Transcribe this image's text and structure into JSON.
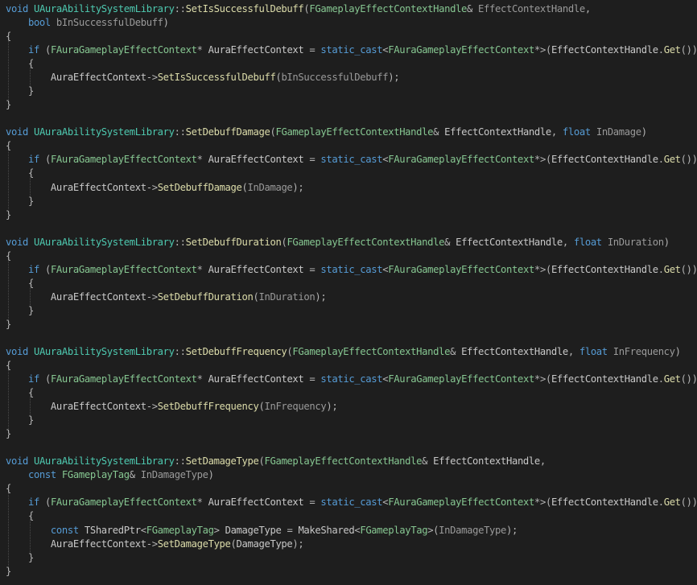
{
  "editor": {
    "colors": {
      "background": "#1e1e1e",
      "keyword": "#569cd6",
      "class": "#4ec9b0",
      "function": "#dcdcaa",
      "parameter": "#9a9a9a",
      "punctuation": "#b4b4b4",
      "variable": "#c8c8c8"
    },
    "lines": [
      [
        [
          "kw",
          "void"
        ],
        [
          "var",
          " "
        ],
        [
          "cls",
          "UAuraAbilitySystemLibrary"
        ],
        [
          "pun",
          "::"
        ],
        [
          "fn",
          "SetIsSuccessfulDebuff"
        ],
        [
          "pun",
          "("
        ],
        [
          "type",
          "FGameplayEffectContextHandle"
        ],
        [
          "pun",
          "&"
        ],
        [
          "var",
          " "
        ],
        [
          "par",
          "EffectContextHandle"
        ],
        [
          "pun",
          ","
        ]
      ],
      [
        [
          "var",
          "    "
        ],
        [
          "kw",
          "bool"
        ],
        [
          "var",
          " "
        ],
        [
          "par",
          "bInSuccessfulDebuff"
        ],
        [
          "pun",
          ")"
        ]
      ],
      [
        [
          "pun",
          "{"
        ]
      ],
      [
        [
          "var",
          "    "
        ],
        [
          "kw",
          "if"
        ],
        [
          "var",
          " "
        ],
        [
          "pun",
          "("
        ],
        [
          "type",
          "FAuraGameplayEffectContext"
        ],
        [
          "op",
          "*"
        ],
        [
          "var",
          " AuraEffectContext "
        ],
        [
          "op",
          "="
        ],
        [
          "var",
          " "
        ],
        [
          "kw",
          "static_cast"
        ],
        [
          "pun",
          "<"
        ],
        [
          "type",
          "FAuraGameplayEffectContext"
        ],
        [
          "op",
          "*"
        ],
        [
          "pun",
          ">("
        ],
        [
          "var",
          "EffectContextHandle"
        ],
        [
          "pun",
          "."
        ],
        [
          "fn",
          "Get"
        ],
        [
          "pun",
          "()))"
        ]
      ],
      [
        [
          "var",
          "    "
        ],
        [
          "pun",
          "{"
        ]
      ],
      [
        [
          "var",
          "        "
        ],
        [
          "var",
          "AuraEffectContext"
        ],
        [
          "op",
          "->"
        ],
        [
          "fn",
          "SetIsSuccessfulDebuff"
        ],
        [
          "pun",
          "("
        ],
        [
          "par",
          "bInSuccessfulDebuff"
        ],
        [
          "pun",
          ");"
        ]
      ],
      [
        [
          "var",
          "    "
        ],
        [
          "pun",
          "}"
        ]
      ],
      [
        [
          "pun",
          "}"
        ]
      ],
      [],
      [
        [
          "kw",
          "void"
        ],
        [
          "var",
          " "
        ],
        [
          "cls",
          "UAuraAbilitySystemLibrary"
        ],
        [
          "pun",
          "::"
        ],
        [
          "fn",
          "SetDebuffDamage"
        ],
        [
          "pun",
          "("
        ],
        [
          "type",
          "FGameplayEffectContextHandle"
        ],
        [
          "pun",
          "&"
        ],
        [
          "var",
          " EffectContextHandle"
        ],
        [
          "pun",
          ","
        ],
        [
          "var",
          " "
        ],
        [
          "kw",
          "float"
        ],
        [
          "var",
          " "
        ],
        [
          "par",
          "InDamage"
        ],
        [
          "pun",
          ")"
        ]
      ],
      [
        [
          "pun",
          "{"
        ]
      ],
      [
        [
          "var",
          "    "
        ],
        [
          "kw",
          "if"
        ],
        [
          "var",
          " "
        ],
        [
          "pun",
          "("
        ],
        [
          "type",
          "FAuraGameplayEffectContext"
        ],
        [
          "op",
          "*"
        ],
        [
          "var",
          " AuraEffectContext "
        ],
        [
          "op",
          "="
        ],
        [
          "var",
          " "
        ],
        [
          "kw",
          "static_cast"
        ],
        [
          "pun",
          "<"
        ],
        [
          "type",
          "FAuraGameplayEffectContext"
        ],
        [
          "op",
          "*"
        ],
        [
          "pun",
          ">("
        ],
        [
          "var",
          "EffectContextHandle"
        ],
        [
          "pun",
          "."
        ],
        [
          "fn",
          "Get"
        ],
        [
          "pun",
          "()))"
        ]
      ],
      [
        [
          "var",
          "    "
        ],
        [
          "pun",
          "{"
        ]
      ],
      [
        [
          "var",
          "        "
        ],
        [
          "var",
          "AuraEffectContext"
        ],
        [
          "op",
          "->"
        ],
        [
          "fn",
          "SetDebuffDamage"
        ],
        [
          "pun",
          "("
        ],
        [
          "par",
          "InDamage"
        ],
        [
          "pun",
          ");"
        ]
      ],
      [
        [
          "var",
          "    "
        ],
        [
          "pun",
          "}"
        ]
      ],
      [
        [
          "pun",
          "}"
        ]
      ],
      [],
      [
        [
          "kw",
          "void"
        ],
        [
          "var",
          " "
        ],
        [
          "cls",
          "UAuraAbilitySystemLibrary"
        ],
        [
          "pun",
          "::"
        ],
        [
          "fn",
          "SetDebuffDuration"
        ],
        [
          "pun",
          "("
        ],
        [
          "type",
          "FGameplayEffectContextHandle"
        ],
        [
          "pun",
          "&"
        ],
        [
          "var",
          " EffectContextHandle"
        ],
        [
          "pun",
          ","
        ],
        [
          "var",
          " "
        ],
        [
          "kw",
          "float"
        ],
        [
          "var",
          " "
        ],
        [
          "par",
          "InDuration"
        ],
        [
          "pun",
          ")"
        ]
      ],
      [
        [
          "pun",
          "{"
        ]
      ],
      [
        [
          "var",
          "    "
        ],
        [
          "kw",
          "if"
        ],
        [
          "var",
          " "
        ],
        [
          "pun",
          "("
        ],
        [
          "type",
          "FAuraGameplayEffectContext"
        ],
        [
          "op",
          "*"
        ],
        [
          "var",
          " AuraEffectContext "
        ],
        [
          "op",
          "="
        ],
        [
          "var",
          " "
        ],
        [
          "kw",
          "static_cast"
        ],
        [
          "pun",
          "<"
        ],
        [
          "type",
          "FAuraGameplayEffectContext"
        ],
        [
          "op",
          "*"
        ],
        [
          "pun",
          ">("
        ],
        [
          "var",
          "EffectContextHandle"
        ],
        [
          "pun",
          "."
        ],
        [
          "fn",
          "Get"
        ],
        [
          "pun",
          "()))"
        ]
      ],
      [
        [
          "var",
          "    "
        ],
        [
          "pun",
          "{"
        ]
      ],
      [
        [
          "var",
          "        "
        ],
        [
          "var",
          "AuraEffectContext"
        ],
        [
          "op",
          "->"
        ],
        [
          "fn",
          "SetDebuffDuration"
        ],
        [
          "pun",
          "("
        ],
        [
          "par",
          "InDuration"
        ],
        [
          "pun",
          ");"
        ]
      ],
      [
        [
          "var",
          "    "
        ],
        [
          "pun",
          "}"
        ]
      ],
      [
        [
          "pun",
          "}"
        ]
      ],
      [],
      [
        [
          "kw",
          "void"
        ],
        [
          "var",
          " "
        ],
        [
          "cls",
          "UAuraAbilitySystemLibrary"
        ],
        [
          "pun",
          "::"
        ],
        [
          "fn",
          "SetDebuffFrequency"
        ],
        [
          "pun",
          "("
        ],
        [
          "type",
          "FGameplayEffectContextHandle"
        ],
        [
          "pun",
          "&"
        ],
        [
          "var",
          " EffectContextHandle"
        ],
        [
          "pun",
          ","
        ],
        [
          "var",
          " "
        ],
        [
          "kw",
          "float"
        ],
        [
          "var",
          " "
        ],
        [
          "par",
          "InFrequency"
        ],
        [
          "pun",
          ")"
        ]
      ],
      [
        [
          "pun",
          "{"
        ]
      ],
      [
        [
          "var",
          "    "
        ],
        [
          "kw",
          "if"
        ],
        [
          "var",
          " "
        ],
        [
          "pun",
          "("
        ],
        [
          "type",
          "FAuraGameplayEffectContext"
        ],
        [
          "op",
          "*"
        ],
        [
          "var",
          " AuraEffectContext "
        ],
        [
          "op",
          "="
        ],
        [
          "var",
          " "
        ],
        [
          "kw",
          "static_cast"
        ],
        [
          "pun",
          "<"
        ],
        [
          "type",
          "FAuraGameplayEffectContext"
        ],
        [
          "op",
          "*"
        ],
        [
          "pun",
          ">("
        ],
        [
          "var",
          "EffectContextHandle"
        ],
        [
          "pun",
          "."
        ],
        [
          "fn",
          "Get"
        ],
        [
          "pun",
          "()))"
        ]
      ],
      [
        [
          "var",
          "    "
        ],
        [
          "pun",
          "{"
        ]
      ],
      [
        [
          "var",
          "        "
        ],
        [
          "var",
          "AuraEffectContext"
        ],
        [
          "op",
          "->"
        ],
        [
          "fn",
          "SetDebuffFrequency"
        ],
        [
          "pun",
          "("
        ],
        [
          "par",
          "InFrequency"
        ],
        [
          "pun",
          ");"
        ]
      ],
      [
        [
          "var",
          "    "
        ],
        [
          "pun",
          "}"
        ]
      ],
      [
        [
          "pun",
          "}"
        ]
      ],
      [],
      [
        [
          "kw",
          "void"
        ],
        [
          "var",
          " "
        ],
        [
          "cls",
          "UAuraAbilitySystemLibrary"
        ],
        [
          "pun",
          "::"
        ],
        [
          "fn",
          "SetDamageType"
        ],
        [
          "pun",
          "("
        ],
        [
          "type",
          "FGameplayEffectContextHandle"
        ],
        [
          "pun",
          "&"
        ],
        [
          "var",
          " EffectContextHandle"
        ],
        [
          "pun",
          ","
        ]
      ],
      [
        [
          "var",
          "    "
        ],
        [
          "kw",
          "const"
        ],
        [
          "var",
          " "
        ],
        [
          "type",
          "FGameplayTag"
        ],
        [
          "pun",
          "&"
        ],
        [
          "var",
          " "
        ],
        [
          "par",
          "InDamageType"
        ],
        [
          "pun",
          ")"
        ]
      ],
      [
        [
          "pun",
          "{"
        ]
      ],
      [
        [
          "var",
          "    "
        ],
        [
          "kw",
          "if"
        ],
        [
          "var",
          " "
        ],
        [
          "pun",
          "("
        ],
        [
          "type",
          "FAuraGameplayEffectContext"
        ],
        [
          "op",
          "*"
        ],
        [
          "var",
          " AuraEffectContext "
        ],
        [
          "op",
          "="
        ],
        [
          "var",
          " "
        ],
        [
          "kw",
          "static_cast"
        ],
        [
          "pun",
          "<"
        ],
        [
          "type",
          "FAuraGameplayEffectContext"
        ],
        [
          "op",
          "*"
        ],
        [
          "pun",
          ">("
        ],
        [
          "var",
          "EffectContextHandle"
        ],
        [
          "pun",
          "."
        ],
        [
          "fn",
          "Get"
        ],
        [
          "pun",
          "()))"
        ]
      ],
      [
        [
          "var",
          "    "
        ],
        [
          "pun",
          "{"
        ]
      ],
      [
        [
          "var",
          "        "
        ],
        [
          "kw",
          "const"
        ],
        [
          "var",
          " TSharedPtr"
        ],
        [
          "pun",
          "<"
        ],
        [
          "type",
          "FGameplayTag"
        ],
        [
          "pun",
          "> "
        ],
        [
          "var",
          "DamageType "
        ],
        [
          "op",
          "="
        ],
        [
          "var",
          " MakeShared"
        ],
        [
          "pun",
          "<"
        ],
        [
          "type",
          "FGameplayTag"
        ],
        [
          "pun",
          ">("
        ],
        [
          "par",
          "InDamageType"
        ],
        [
          "pun",
          ");"
        ]
      ],
      [
        [
          "var",
          "        "
        ],
        [
          "var",
          "AuraEffectContext"
        ],
        [
          "op",
          "->"
        ],
        [
          "fn",
          "SetDamageType"
        ],
        [
          "pun",
          "("
        ],
        [
          "var",
          "DamageType"
        ],
        [
          "pun",
          ");"
        ]
      ],
      [
        [
          "var",
          "    "
        ],
        [
          "pun",
          "}"
        ]
      ],
      [
        [
          "pun",
          "}"
        ]
      ]
    ]
  }
}
